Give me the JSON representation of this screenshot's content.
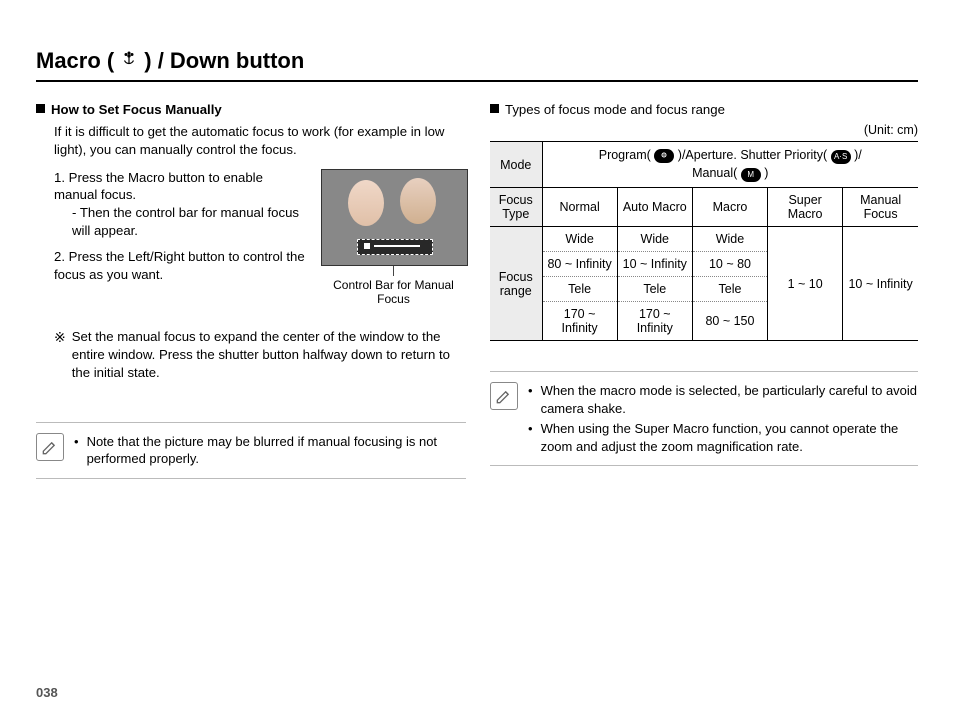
{
  "title_prefix": "Macro (",
  "title_suffix": ") / Down button",
  "left": {
    "heading": "How to Set Focus Manually",
    "intro": "If it is difficult to get the automatic focus to work (for example in low light), you can manually control the focus.",
    "step1": "1. Press the Macro button to enable manual focus.",
    "step1a": "- Then the control bar for manual focus will appear.",
    "step2": "2. Press the Left/Right button to control the focus as you want.",
    "caption": "Control Bar for Manual Focus",
    "ref_mark": "※",
    "ref_text": "Set the manual focus to expand the center of the window to the entire window. Press the shutter button halfway down to return to the initial state.",
    "note": "Note that the picture may be blurred if manual focusing is not performed properly."
  },
  "right": {
    "heading": "Types of focus mode and focus range",
    "unit": "(Unit: cm)",
    "table": {
      "mode_label": "Mode",
      "mode_value_a": "Program(",
      "mode_value_b": ")/Aperture. Shutter Priority(",
      "mode_value_c": ")/",
      "mode_value_d": "Manual(",
      "mode_value_e": ")",
      "focus_type_label": "Focus Type",
      "focus_types": [
        "Normal",
        "Auto Macro",
        "Macro",
        "Super Macro",
        "Manual Focus"
      ],
      "focus_range_label": "Focus range",
      "wide_label": "Wide",
      "tele_label": "Tele",
      "wide_vals": [
        "80 ~ Infinity",
        "10 ~ Infinity",
        "10 ~ 80"
      ],
      "tele_vals": [
        "170 ~ Infinity",
        "170 ~ Infinity",
        "80 ~ 150"
      ],
      "super_macro_val": "1 ~ 10",
      "manual_focus_val": "10 ~ Infinity"
    },
    "notes": [
      "When the macro mode is selected, be particularly careful to avoid camera shake.",
      "When using the Super Macro function, you cannot operate the zoom and adjust the zoom magnification rate."
    ]
  },
  "page_number": "038"
}
